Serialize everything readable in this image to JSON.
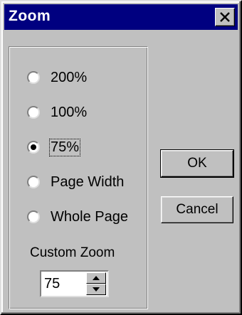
{
  "window": {
    "title": "Zoom"
  },
  "zoom_options": [
    {
      "label": "200%",
      "selected": false
    },
    {
      "label": "100%",
      "selected": false
    },
    {
      "label": "75%",
      "selected": true
    },
    {
      "label": "Page Width",
      "selected": false
    },
    {
      "label": "Whole Page",
      "selected": false
    }
  ],
  "custom_zoom": {
    "label": "Custom Zoom",
    "value": "75"
  },
  "buttons": {
    "ok": "OK",
    "cancel": "Cancel"
  },
  "icons": {
    "close": "close-icon",
    "spin_up": "spin-up-icon",
    "spin_down": "spin-down-icon"
  },
  "colors": {
    "titlebar": "#000080",
    "face": "#c0c0c0"
  }
}
